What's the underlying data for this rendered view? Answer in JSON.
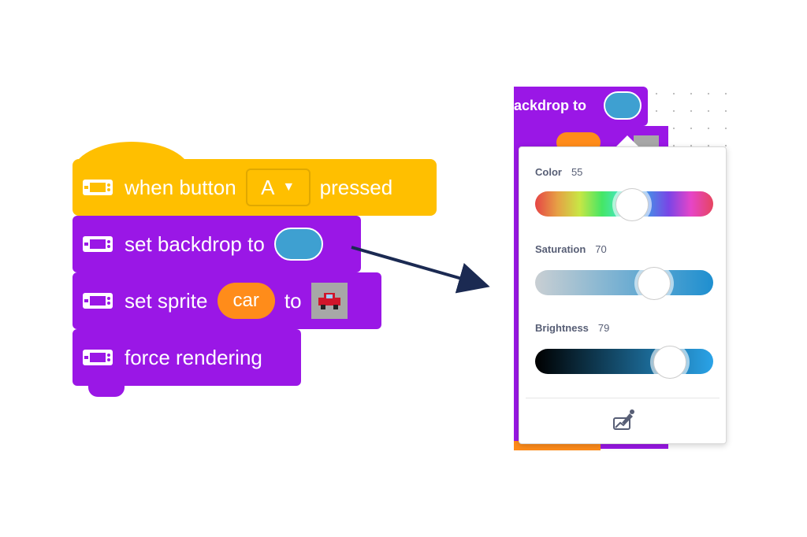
{
  "blocks": {
    "hat": {
      "when_label": "when button",
      "button_value": "A",
      "pressed_label": "pressed"
    },
    "set_backdrop": {
      "label": "set backdrop to",
      "color": "#3ea0d1"
    },
    "set_sprite": {
      "label": "set sprite",
      "sprite_value": "car",
      "to_label": "to"
    },
    "force_rendering": {
      "label": "force rendering"
    }
  },
  "picker": {
    "cropped_block_label": "ackdrop to",
    "color_label": "Color",
    "color_value": "55",
    "saturation_label": "Saturation",
    "saturation_value": "70",
    "brightness_label": "Brightness",
    "brightness_value": "79",
    "eyedropper_icon": "eyedropper-icon"
  },
  "colors": {
    "event_yellow": "#ffbf00",
    "extension_purple": "#9a17e6",
    "sprite_orange": "#ff8c1a",
    "selected_color": "#3ea0d1",
    "arrow": "#1b2a52"
  }
}
